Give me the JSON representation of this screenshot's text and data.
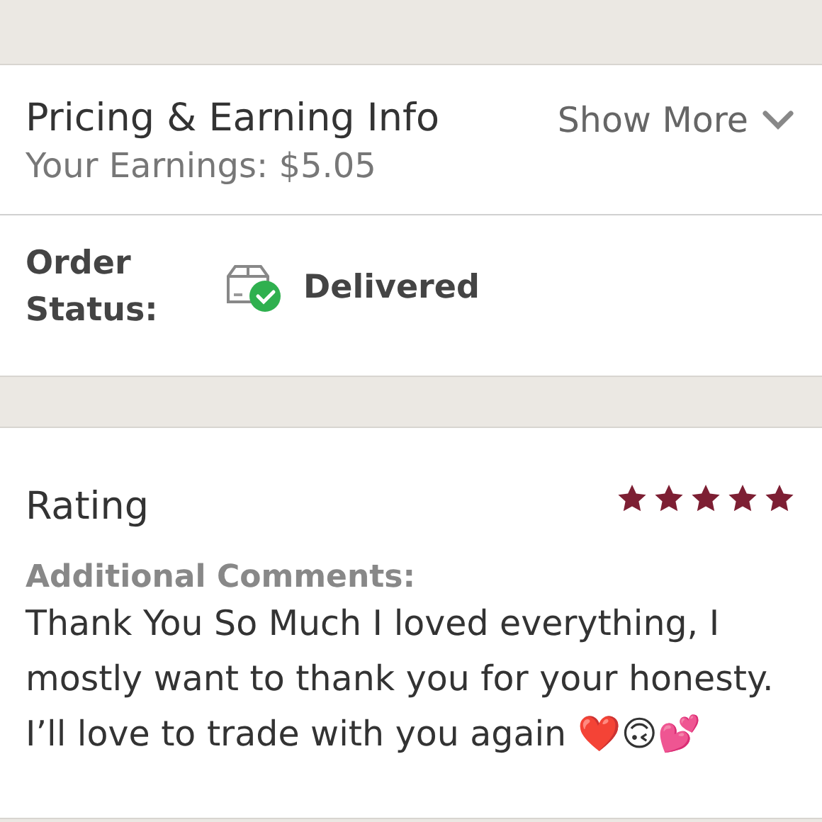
{
  "pricing": {
    "title": "Pricing & Earning Info",
    "earnings": "Your Earnings: $5.05",
    "toggle": "Show More",
    "expanded": false
  },
  "order": {
    "label": "Order Status:",
    "status": "Delivered",
    "delivered": true
  },
  "rating": {
    "label": "Rating",
    "stars": 5
  },
  "comments": {
    "label": "Additional Comments:",
    "text": "Thank You So Much I loved everything, I mostly want to thank you for your honesty. I’ll love to trade with you again ❤️🙃💕"
  }
}
